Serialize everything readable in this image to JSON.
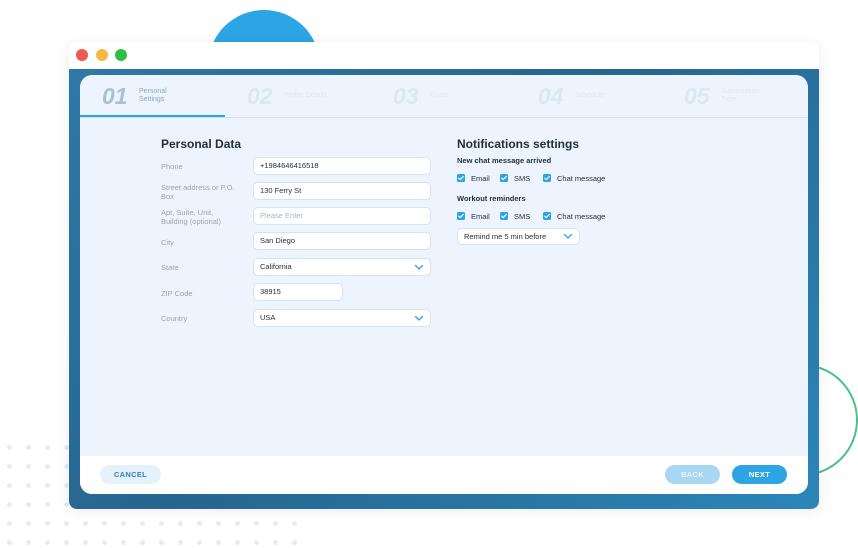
{
  "steps": [
    {
      "number": "01",
      "label": "Personal Settings"
    },
    {
      "number": "02",
      "label": "Profile Details"
    },
    {
      "number": "03",
      "label": "Goals"
    },
    {
      "number": "04",
      "label": "Schedule"
    },
    {
      "number": "05",
      "label": "Subscription Type"
    }
  ],
  "personal": {
    "title": "Personal Data",
    "fields": {
      "phone": {
        "label": "Phone",
        "value": "+1984646416518"
      },
      "street": {
        "label": "Street address or P.O. Box",
        "value": "130 Ferry St"
      },
      "apt": {
        "label": "Apt, Suite, Unit, Building (optional)",
        "placeholder": "Please Enter"
      },
      "city": {
        "label": "City",
        "value": "San Diego"
      },
      "state": {
        "label": "State",
        "value": "California"
      },
      "zip": {
        "label": "ZIP Code",
        "value": "38915"
      },
      "country": {
        "label": "Country",
        "value": "USA"
      }
    }
  },
  "notifications": {
    "title": "Notifications settings",
    "chat": {
      "title": "New chat message arrived",
      "options": [
        {
          "label": "Email",
          "checked": true
        },
        {
          "label": "SMS",
          "checked": true
        },
        {
          "label": "Chat message",
          "checked": true
        }
      ]
    },
    "workout": {
      "title": "Workout reminders",
      "options": [
        {
          "label": "Email",
          "checked": true
        },
        {
          "label": "SMS",
          "checked": true
        },
        {
          "label": "Chat message",
          "checked": true
        }
      ]
    },
    "remind_value": "Remind me 5 min before"
  },
  "footer": {
    "cancel": "CANCEL",
    "back": "BACK",
    "next": "NEXT"
  },
  "colors": {
    "accent": "#2da4e4",
    "frame": "#2f78a7",
    "card": "#eef4fd"
  },
  "icons": {
    "checkbox": "check-icon",
    "dropdown": "chevron-down-icon"
  }
}
